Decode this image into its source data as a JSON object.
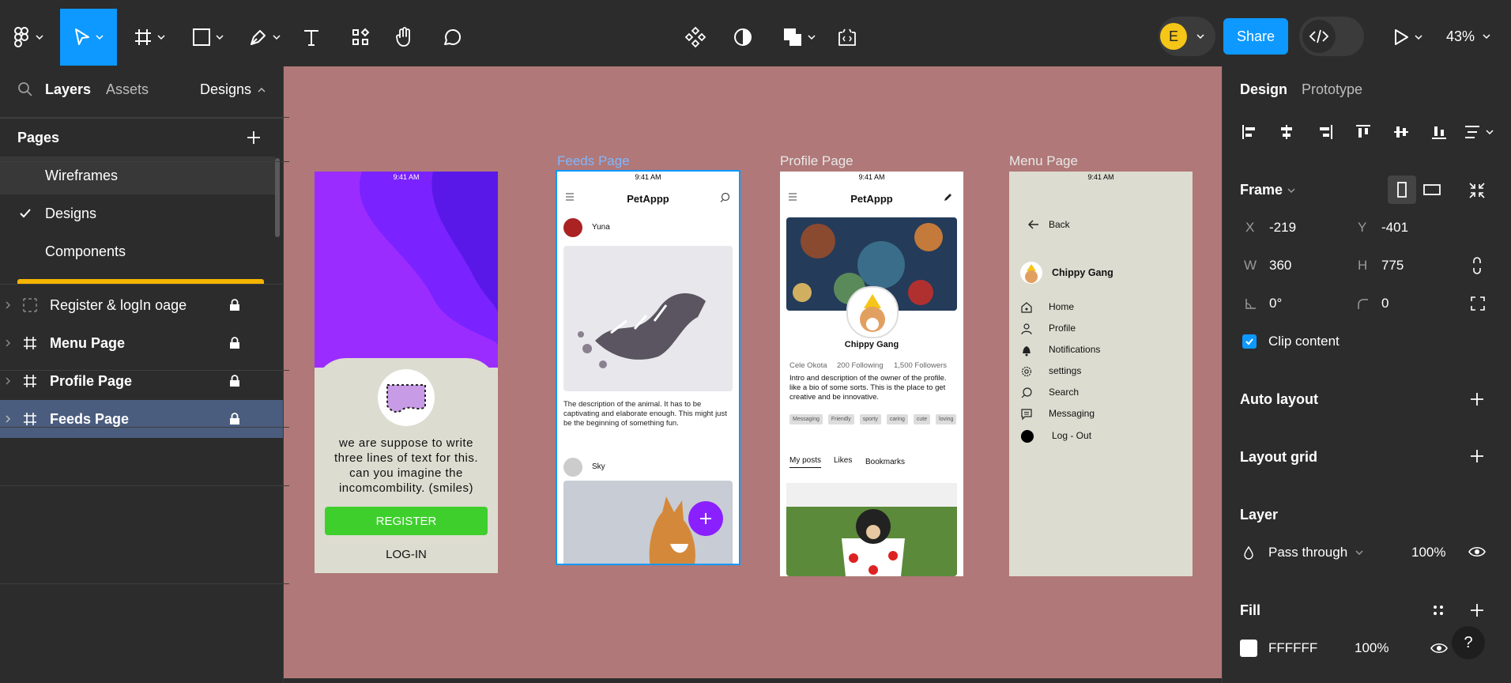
{
  "toolbar": {
    "share_label": "Share",
    "zoom": "43%",
    "avatar_initial": "E"
  },
  "left_panel": {
    "tabs": {
      "layers": "Layers",
      "assets": "Assets",
      "designs": "Designs"
    },
    "pages_title": "Pages",
    "pages": [
      {
        "label": "Wireframes"
      },
      {
        "label": "Designs"
      },
      {
        "label": "Components"
      }
    ],
    "layers": [
      {
        "label": "Register & logIn oage"
      },
      {
        "label": "Menu Page"
      },
      {
        "label": "Profile Page"
      },
      {
        "label": "Feeds Page"
      }
    ]
  },
  "canvas": {
    "frames": {
      "feeds_label": "Feeds Page",
      "profile_label": "Profile Page",
      "menu_label": "Menu Page"
    },
    "status_time": "9:41 AM",
    "register": {
      "body_text": "we are suppose to write three lines of text for this. can you imagine the incomcombility. (smiles)",
      "register_btn": "REGISTER",
      "login_btn": "LOG-IN"
    },
    "feeds": {
      "app_title": "PetAppp",
      "user1": "Yuna",
      "description": "The description of the animal. It has to be captivating and elaborate enough. This might just be the beginning of something fun.",
      "user2": "Sky"
    },
    "profile": {
      "app_title": "PetAppp",
      "name": "Chippy Gang",
      "handle": "Cele Okota",
      "following": "200 Following",
      "followers": "1,500 Followers",
      "bio": "Intro and description of the  owner of the profile. like a bio of some sorts. This is the place to get creative and be innovative.",
      "tags": [
        "Messaging",
        "Friendly",
        "sporty",
        "caring",
        "cute",
        "loving"
      ],
      "tabs": [
        "My posts",
        "Likes",
        "Bookmarks"
      ]
    },
    "menu": {
      "back": "Back",
      "name": "Chippy Gang",
      "items": [
        "Home",
        "Profile",
        "Notifications",
        "settings",
        "Search",
        "Messaging",
        "Log - Out"
      ]
    }
  },
  "right_panel": {
    "tabs": {
      "design": "Design",
      "prototype": "Prototype"
    },
    "frame_title": "Frame",
    "x_label": "X",
    "x": "-219",
    "y_label": "Y",
    "y": "-401",
    "w_label": "W",
    "w": "360",
    "h_label": "H",
    "h": "775",
    "rotation": "0°",
    "radius": "0",
    "clip_content": "Clip content",
    "auto_layout": "Auto layout",
    "layout_grid": "Layout grid",
    "layer_title": "Layer",
    "blend": "Pass through",
    "opacity": "100%",
    "fill_title": "Fill",
    "fill_hex": "FFFFFF",
    "fill_opacity": "100%",
    "help": "?"
  },
  "colors": {
    "accent": "#0d99ff",
    "canvas_bg": "#b07878",
    "selected_layer": "#4a5d7e",
    "purple": "#8a1fff",
    "register_green": "#3ecf2d",
    "avatar_yellow": "#f5c518"
  }
}
